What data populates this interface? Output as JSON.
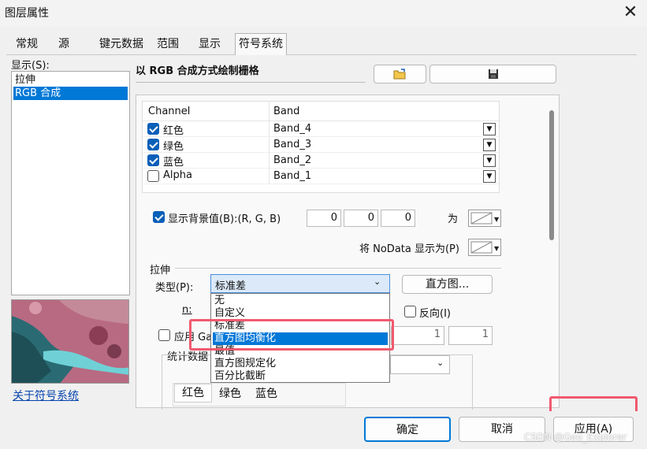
{
  "window": {
    "title": "图层属性",
    "close_glyph": "✕"
  },
  "tabs": [
    {
      "label": "常规"
    },
    {
      "label": "源"
    },
    {
      "label": "键元数据"
    },
    {
      "label": "范围"
    },
    {
      "label": "显示"
    },
    {
      "label": "符号系统"
    }
  ],
  "left": {
    "show_label": "显示(S):",
    "items": [
      {
        "label": "拉伸",
        "selected": false
      },
      {
        "label": "RGB 合成",
        "selected": true
      }
    ],
    "about_link": "关于符号系统"
  },
  "main": {
    "heading": "以 RGB 合成方式绘制栅格",
    "channel_table": {
      "headers": [
        "Channel",
        "Band"
      ],
      "rows": [
        {
          "channel": "红色",
          "band": "Band_4",
          "checked": true
        },
        {
          "channel": "绿色",
          "band": "Band_3",
          "checked": true
        },
        {
          "channel": "蓝色",
          "band": "Band_2",
          "checked": true
        },
        {
          "channel": "Alpha",
          "band": "Band_1",
          "checked": false
        }
      ]
    },
    "background": {
      "label": "显示背景值(B):(R, G, B)",
      "checked": true,
      "r": "0",
      "g": "0",
      "b": "0",
      "as_label": "为"
    },
    "nodata_label": "将 NoData 显示为(P)",
    "stretch": {
      "group_label": "拉伸",
      "type_label": "类型(P):",
      "type_value": "标准差",
      "histogram_button": "直方图...",
      "n_label": "n:",
      "invert_label": "反向(I)",
      "apply_gamma_label": "应用 Ga",
      "gamma_values": [
        "1",
        "1"
      ],
      "stats_label": "统计数据",
      "color_tabs": [
        "红色",
        "绿色",
        "蓝色"
      ]
    },
    "dropdown_options": [
      "无",
      "自定义",
      "标准差",
      "直方图均衡化",
      "最值",
      "直方图规定化",
      "百分比截断"
    ],
    "dropdown_highlighted": "直方图均衡化"
  },
  "footer": {
    "ok": "确定",
    "cancel": "取消",
    "apply": "应用(A)",
    "watermark": "CSDN @Geo_Explorer"
  },
  "colors": {
    "accent": "#0078d7",
    "highlight_box": "#f05a6e"
  }
}
